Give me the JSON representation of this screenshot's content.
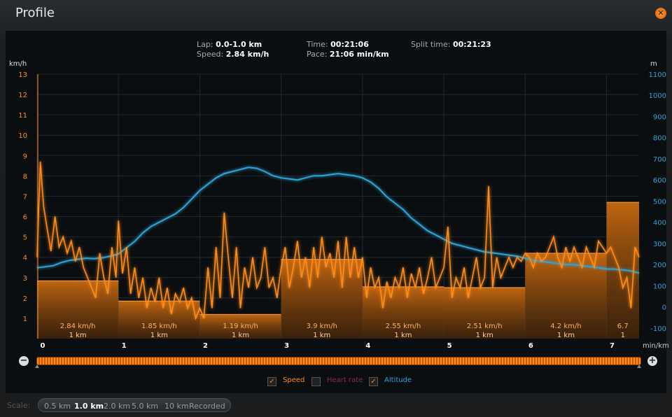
{
  "window": {
    "title": "Profile"
  },
  "info": {
    "lap_label": "Lap:",
    "lap_value": "0.0-1.0 km",
    "speed_label": "Speed:",
    "speed_value": "2.84 km/h",
    "time_label": "Time:",
    "time_value": "00:21:06",
    "pace_label": "Pace:",
    "pace_value": "21:06 min/km",
    "split_label": "Split time:",
    "split_value": "00:21:23"
  },
  "legend": {
    "speed": {
      "label": "Speed",
      "checked": true,
      "color": "#ff8c1a"
    },
    "heart": {
      "label": "Heart rate",
      "checked": false,
      "color": "#8a2a5a"
    },
    "altitude": {
      "label": "Altitude",
      "checked": true,
      "color": "#2fa4d6"
    }
  },
  "scale": {
    "label": "Scale:",
    "options": [
      "0.5 km",
      "1.0 km",
      "2.0 km",
      "5.0 km",
      "10 km",
      "Recorded"
    ],
    "active": "1.0 km"
  },
  "chart_data": {
    "type": "line",
    "xlabel": "min/km",
    "ylabel_left": "km/h",
    "ylabel_right": "m",
    "xlim": [
      0,
      7.4
    ],
    "ylim_left": [
      0,
      13
    ],
    "ylim_right": [
      -150,
      1100
    ],
    "x_ticks": [
      0,
      1,
      2,
      3,
      4,
      5,
      6,
      7
    ],
    "y_ticks_left": [
      1,
      2,
      3,
      4,
      5,
      6,
      7,
      8,
      9,
      10,
      11,
      12,
      13
    ],
    "y_ticks_right": [
      -100,
      0,
      100,
      200,
      300,
      400,
      500,
      600,
      700,
      800,
      900,
      1000,
      1100
    ],
    "grid": true,
    "laps": [
      {
        "start": 0,
        "end": 1,
        "speed": 2.84,
        "label": "2.84 km/h",
        "dist": "1 km"
      },
      {
        "start": 1,
        "end": 2,
        "speed": 1.85,
        "label": "1.85 km/h",
        "dist": "1 km"
      },
      {
        "start": 2,
        "end": 3,
        "speed": 1.19,
        "label": "1.19 km/h",
        "dist": "1 km"
      },
      {
        "start": 3,
        "end": 4,
        "speed": 3.9,
        "label": "3.9 km/h",
        "dist": "1 km"
      },
      {
        "start": 4,
        "end": 5,
        "speed": 2.55,
        "label": "2.55 km/h",
        "dist": "1 km"
      },
      {
        "start": 5,
        "end": 6,
        "speed": 2.51,
        "label": "2.51 km/h",
        "dist": "1 km"
      },
      {
        "start": 6,
        "end": 7,
        "speed": 4.2,
        "label": "4.2 km/h",
        "dist": "1 km"
      },
      {
        "start": 7,
        "end": 7.4,
        "speed": 6.7,
        "label": "6.7",
        "dist": "1"
      }
    ],
    "series": [
      {
        "name": "Speed",
        "x": [
          0,
          0.04,
          0.08,
          0.12,
          0.17,
          0.22,
          0.27,
          0.32,
          0.37,
          0.42,
          0.47,
          0.52,
          0.57,
          0.62,
          0.67,
          0.72,
          0.77,
          0.82,
          0.87,
          0.92,
          0.97,
          1.0,
          1.05,
          1.1,
          1.15,
          1.2,
          1.25,
          1.3,
          1.35,
          1.4,
          1.45,
          1.5,
          1.55,
          1.6,
          1.65,
          1.7,
          1.75,
          1.8,
          1.85,
          1.9,
          1.95,
          2.0,
          2.05,
          2.1,
          2.15,
          2.2,
          2.25,
          2.3,
          2.35,
          2.4,
          2.45,
          2.5,
          2.55,
          2.6,
          2.65,
          2.7,
          2.75,
          2.8,
          2.85,
          2.9,
          2.95,
          3.0,
          3.05,
          3.1,
          3.15,
          3.2,
          3.25,
          3.3,
          3.35,
          3.4,
          3.45,
          3.5,
          3.55,
          3.6,
          3.65,
          3.7,
          3.75,
          3.8,
          3.85,
          3.9,
          3.95,
          4.0,
          4.05,
          4.1,
          4.15,
          4.2,
          4.25,
          4.3,
          4.35,
          4.4,
          4.45,
          4.5,
          4.55,
          4.6,
          4.65,
          4.7,
          4.75,
          4.8,
          4.85,
          4.9,
          4.95,
          5.0,
          5.05,
          5.1,
          5.15,
          5.2,
          5.25,
          5.3,
          5.35,
          5.4,
          5.45,
          5.5,
          5.55,
          5.6,
          5.65,
          5.7,
          5.75,
          5.8,
          5.85,
          5.9,
          5.95,
          6.0,
          6.05,
          6.1,
          6.15,
          6.2,
          6.25,
          6.3,
          6.35,
          6.4,
          6.45,
          6.5,
          6.55,
          6.6,
          6.65,
          6.7,
          6.75,
          6.8,
          6.85,
          6.9,
          6.95,
          7.0,
          7.05,
          7.1,
          7.15,
          7.2,
          7.25,
          7.3,
          7.35,
          7.4
        ],
        "y": [
          4.0,
          8.7,
          6.5,
          5.5,
          4.3,
          6.0,
          4.5,
          5.0,
          4.2,
          4.8,
          3.8,
          4.5,
          3.5,
          3.0,
          2.5,
          2.0,
          4.2,
          3.0,
          2.2,
          4.5,
          3.0,
          5.8,
          3.2,
          4.5,
          2.2,
          3.5,
          2.0,
          3.0,
          1.5,
          2.5,
          1.8,
          3.0,
          1.5,
          2.5,
          1.2,
          2.2,
          1.8,
          2.5,
          1.5,
          2.0,
          1.0,
          1.5,
          1.0,
          3.5,
          1.5,
          4.5,
          2.0,
          6.2,
          4.0,
          2.0,
          4.5,
          1.5,
          3.5,
          2.5,
          4.0,
          2.5,
          3.0,
          4.5,
          2.5,
          3.0,
          2.0,
          3.5,
          4.5,
          2.5,
          3.5,
          4.8,
          3.0,
          4.0,
          2.5,
          4.5,
          3.0,
          5.0,
          3.5,
          4.2,
          3.0,
          4.8,
          2.5,
          5.0,
          3.0,
          4.5,
          3.0,
          4.0,
          2.0,
          3.5,
          2.5,
          3.0,
          1.5,
          2.8,
          2.0,
          3.0,
          2.5,
          3.5,
          2.0,
          3.2,
          2.5,
          3.5,
          2.2,
          3.0,
          4.0,
          2.5,
          3.0,
          3.5,
          5.5,
          2.0,
          3.0,
          2.5,
          3.5,
          2.0,
          3.0,
          4.0,
          2.5,
          3.0,
          7.5,
          2.5,
          4.0,
          3.0,
          3.5,
          4.0,
          3.5,
          4.0,
          3.8,
          4.2,
          4.0,
          3.5,
          4.2,
          3.8,
          4.0,
          4.5,
          5.0,
          4.0,
          3.5,
          4.5,
          3.8,
          4.5,
          4.0,
          3.5,
          4.5,
          4.0,
          3.5,
          4.8,
          4.5,
          4.2,
          4.5,
          4.0,
          3.5,
          2.5,
          3.0,
          1.5,
          4.5,
          4.0
        ]
      },
      {
        "name": "Altitude",
        "x": [
          0,
          0.1,
          0.2,
          0.3,
          0.4,
          0.5,
          0.6,
          0.7,
          0.8,
          0.9,
          1.0,
          1.1,
          1.2,
          1.3,
          1.4,
          1.5,
          1.6,
          1.7,
          1.8,
          1.9,
          2.0,
          2.1,
          2.2,
          2.3,
          2.4,
          2.5,
          2.6,
          2.7,
          2.8,
          2.9,
          3.0,
          3.1,
          3.2,
          3.3,
          3.4,
          3.5,
          3.6,
          3.7,
          3.8,
          3.9,
          4.0,
          4.1,
          4.2,
          4.3,
          4.4,
          4.5,
          4.6,
          4.7,
          4.8,
          4.9,
          5.0,
          5.1,
          5.2,
          5.3,
          5.4,
          5.5,
          5.6,
          5.7,
          5.8,
          5.9,
          6.0,
          6.1,
          6.2,
          6.3,
          6.4,
          6.5,
          6.6,
          6.7,
          6.8,
          6.9,
          7.0,
          7.1,
          7.2,
          7.3,
          7.4
        ],
        "y": [
          185,
          190,
          195,
          210,
          220,
          225,
          230,
          228,
          232,
          240,
          250,
          280,
          310,
          350,
          380,
          400,
          420,
          440,
          470,
          510,
          550,
          580,
          610,
          630,
          640,
          650,
          660,
          655,
          640,
          620,
          610,
          605,
          600,
          610,
          620,
          620,
          625,
          630,
          625,
          620,
          610,
          590,
          560,
          520,
          490,
          460,
          420,
          390,
          360,
          340,
          320,
          300,
          290,
          280,
          270,
          260,
          255,
          250,
          245,
          240,
          230,
          220,
          215,
          210,
          205,
          200,
          200,
          195,
          190,
          185,
          180,
          178,
          175,
          170,
          160
        ]
      }
    ]
  }
}
